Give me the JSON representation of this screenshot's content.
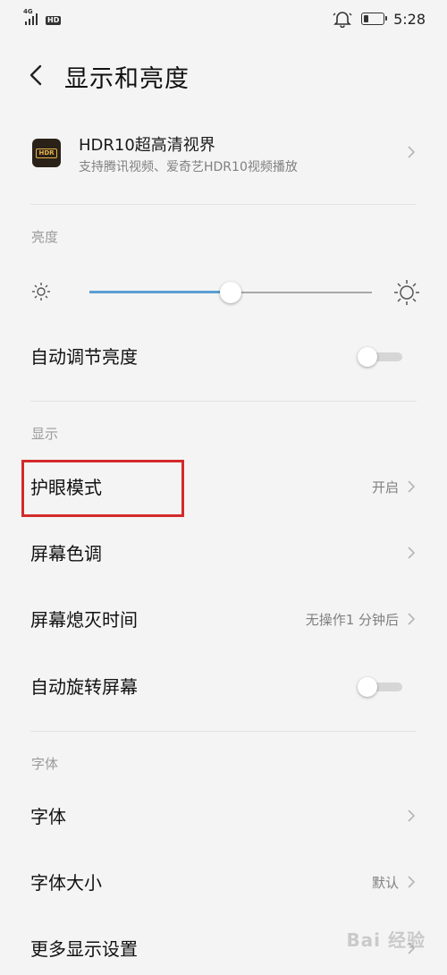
{
  "status_bar": {
    "network": "4G",
    "hd_badge": "HD",
    "time": "5:28",
    "battery_level": 0.25,
    "icons": [
      "signal-icon",
      "alarm-bell-icon",
      "battery-icon"
    ]
  },
  "header": {
    "title": "显示和亮度",
    "back_icon": "back-arrow-icon"
  },
  "hdr": {
    "icon_text": "HDR",
    "title": "HDR10超高清视界",
    "subtitle": "支持腾讯视频、爱奇艺HDR10视频播放"
  },
  "brightness": {
    "section_label": "亮度",
    "level": 0.5,
    "accent_color": "#5b9fd2",
    "auto_label": "自动调节亮度",
    "auto_enabled": false
  },
  "display": {
    "section_label": "显示",
    "eye_comfort": {
      "label": "护眼模式",
      "value": "开启"
    },
    "color_tone": {
      "label": "屏幕色调"
    },
    "screen_timeout": {
      "label": "屏幕熄灭时间",
      "value": "无操作1 分钟后"
    },
    "auto_rotate": {
      "label": "自动旋转屏幕",
      "enabled": false
    }
  },
  "font": {
    "section_label": "字体",
    "font_item": {
      "label": "字体"
    },
    "font_size": {
      "label": "字体大小",
      "value": "默认"
    },
    "more_display": {
      "label": "更多显示设置"
    }
  },
  "annotation": {
    "highlight_color": "#d32a2a"
  },
  "watermark": "Bai 经验"
}
